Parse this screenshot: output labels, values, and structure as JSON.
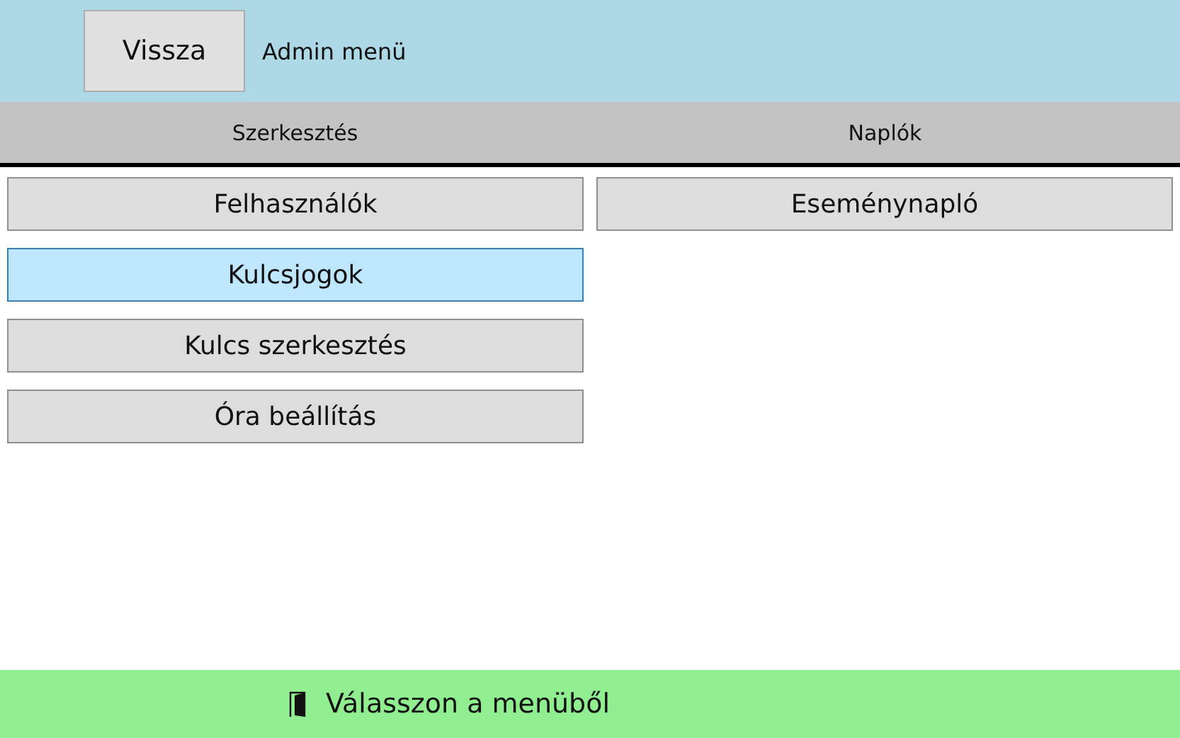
{
  "header": {
    "back_button": "Vissza",
    "title": "Admin menü"
  },
  "columns": [
    {
      "heading": "Szerkesztés",
      "items": [
        {
          "label": "Felhasználók",
          "selected": false
        },
        {
          "label": "Kulcsjogok",
          "selected": true
        },
        {
          "label": "Kulcs szerkesztés",
          "selected": false
        },
        {
          "label": "Óra beállítás",
          "selected": false
        }
      ]
    },
    {
      "heading": "Naplók",
      "items": [
        {
          "label": "Eseménynapló",
          "selected": false
        }
      ]
    }
  ],
  "status_bar": {
    "text": "Válasszon a menüből"
  }
}
